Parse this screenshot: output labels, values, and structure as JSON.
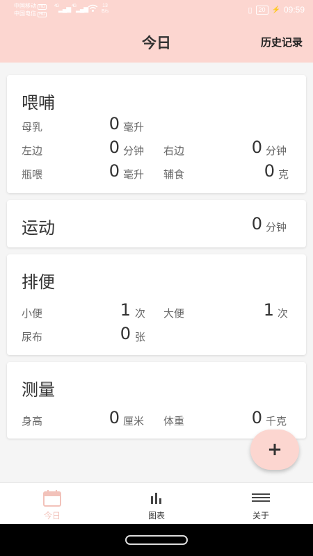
{
  "status_bar": {
    "carrier1": "中国移动",
    "carrier2": "中国电信",
    "hd1": "HD",
    "hd2": "HD",
    "net1": "4G",
    "net2": "4G",
    "speed_value": "13",
    "speed_unit": "B/s",
    "battery": "20",
    "time": "09:59"
  },
  "header": {
    "title": "今日",
    "history_label": "历史记录"
  },
  "feeding": {
    "title": "喂哺",
    "breast_milk": {
      "label": "母乳",
      "value": "0",
      "unit": "毫升"
    },
    "left": {
      "label": "左边",
      "value": "0",
      "unit": "分钟"
    },
    "right": {
      "label": "右边",
      "value": "0",
      "unit": "分钟"
    },
    "bottle": {
      "label": "瓶喂",
      "value": "0",
      "unit": "毫升"
    },
    "solid_food": {
      "label": "辅食",
      "value": "0",
      "unit": "克"
    }
  },
  "exercise": {
    "title": "运动",
    "value": "0",
    "unit": "分钟"
  },
  "excretion": {
    "title": "排便",
    "urine": {
      "label": "小便",
      "value": "1",
      "unit": "次"
    },
    "stool": {
      "label": "大便",
      "value": "1",
      "unit": "次"
    },
    "diaper": {
      "label": "尿布",
      "value": "0",
      "unit": "张"
    }
  },
  "measurement": {
    "title": "测量",
    "height": {
      "label": "身高",
      "value": "0",
      "unit": "厘米"
    },
    "weight": {
      "label": "体重",
      "value": "0",
      "unit": "千克"
    }
  },
  "fab": {
    "icon": "plus-icon",
    "label": "+"
  },
  "bottom_nav": {
    "today": {
      "label": "今日",
      "icon": "calendar-icon"
    },
    "charts": {
      "label": "图表",
      "icon": "bar-chart-icon"
    },
    "about": {
      "label": "关于",
      "icon": "menu-icon"
    }
  },
  "colors": {
    "accent": "#fcd6d0",
    "active_tab": "#f2c2ba",
    "background": "#f5f5f5"
  }
}
